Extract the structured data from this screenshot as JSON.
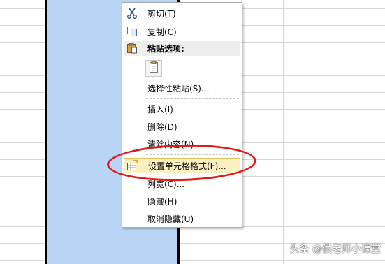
{
  "context_menu": {
    "cut": "剪切(T)",
    "copy": "复制(C)",
    "paste_options": "粘贴选项:",
    "paste_special": "选择性粘贴(S)...",
    "insert": "插入(I)",
    "delete": "删除(D)",
    "clear_contents": "清除内容(N)",
    "format_cells": "设置单元格格式(F)...",
    "column_width": "列宽(C)...",
    "hide": "隐藏(H)",
    "unhide": "取消隐藏(U)"
  },
  "icons": {
    "cut": "scissors-icon",
    "copy": "copy-icon",
    "paste": "clipboard-icon",
    "paste_option": "paste-document-icon",
    "format_cells": "format-cells-icon"
  },
  "colors": {
    "selected_column": "#b8d5f5",
    "annotation_ellipse": "#e21a1a",
    "menu_highlight": "#fbf0c2"
  },
  "watermark": "头条 @侯老师小课堂"
}
